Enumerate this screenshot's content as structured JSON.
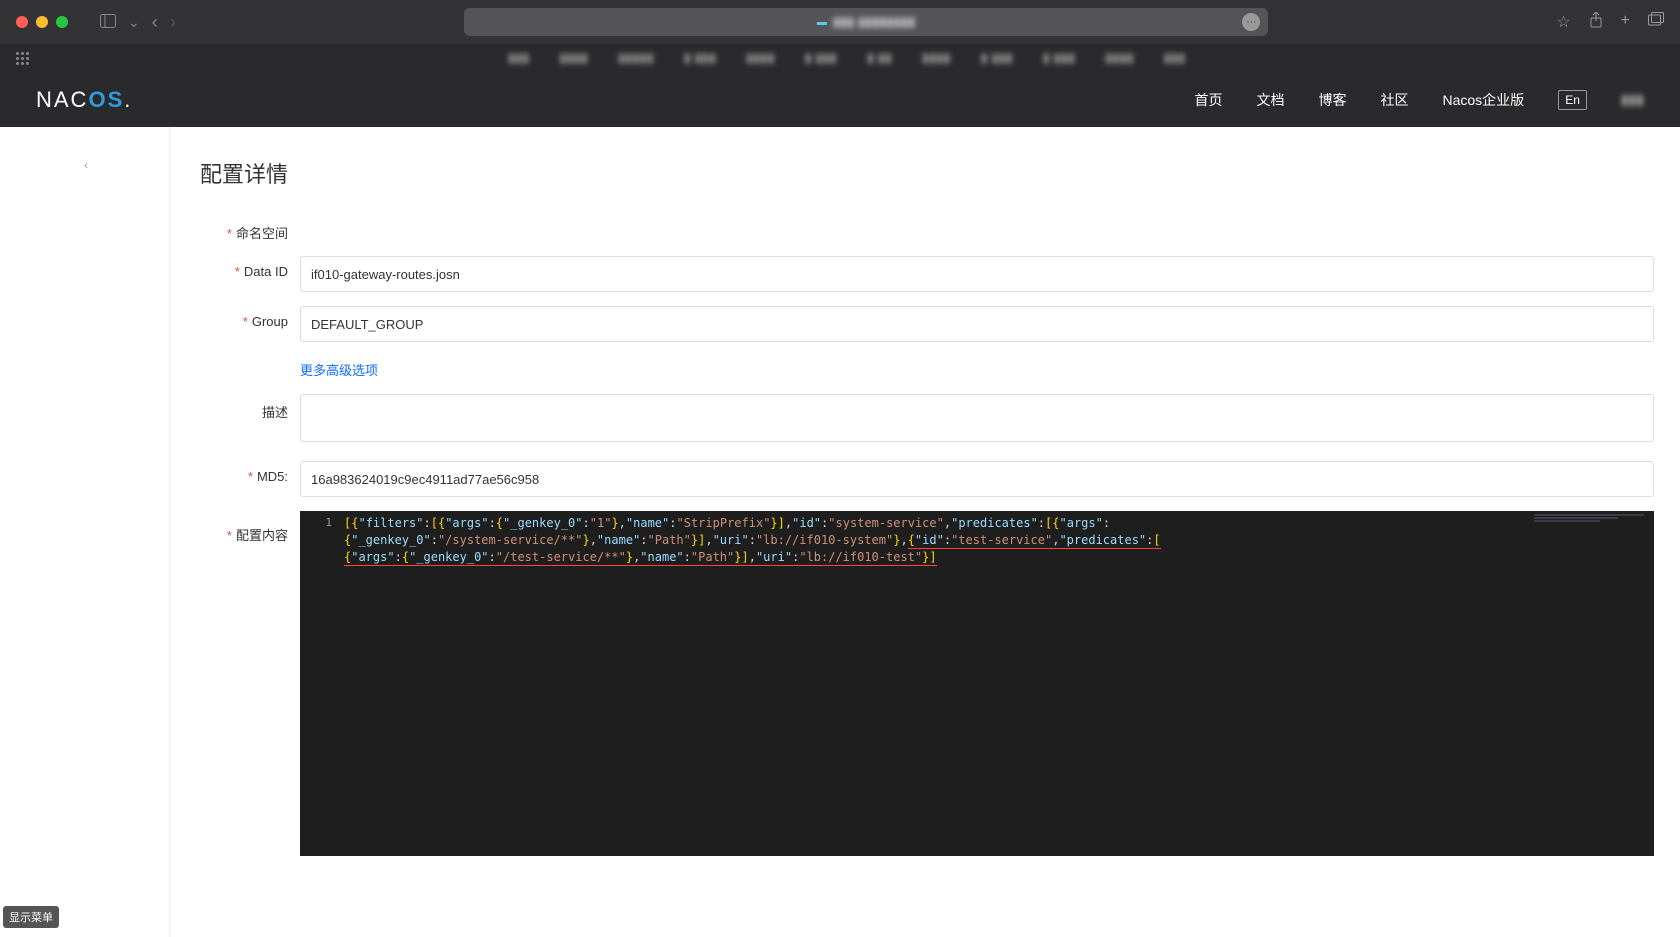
{
  "browser": {
    "addr_blur": "▮▮▮ ▮▮▮▮▮▮▮▮"
  },
  "nacos_header": {
    "nav": [
      "首页",
      "文档",
      "博客",
      "社区",
      "Nacos企业版"
    ],
    "lang": "En",
    "user_blur": "▮▮▮"
  },
  "page": {
    "title": "配置详情",
    "labels": {
      "namespace": "命名空间",
      "data_id": "Data ID",
      "group": "Group",
      "advanced": "更多高级选项",
      "desc": "描述",
      "md5": "MD5:",
      "content": "配置内容"
    },
    "values": {
      "data_id": "if010-gateway-routes.josn",
      "group": "DEFAULT_GROUP",
      "md5": "16a983624019c9ec4911ad77ae56c958"
    },
    "code_tokens": [
      [
        "bracket",
        "["
      ],
      [
        "brace",
        "{"
      ],
      [
        "key",
        "\"filters\""
      ],
      [
        "punc",
        ":"
      ],
      [
        "bracket",
        "["
      ],
      [
        "brace",
        "{"
      ],
      [
        "key",
        "\"args\""
      ],
      [
        "punc",
        ":"
      ],
      [
        "brace",
        "{"
      ],
      [
        "key",
        "\"_genkey_0\""
      ],
      [
        "punc",
        ":"
      ],
      [
        "str",
        "\"1\""
      ],
      [
        "brace",
        "}"
      ],
      [
        "punc",
        ","
      ],
      [
        "key",
        "\"name\""
      ],
      [
        "punc",
        ":"
      ],
      [
        "str",
        "\"StripPrefix\""
      ],
      [
        "brace",
        "}"
      ],
      [
        "bracket",
        "]"
      ],
      [
        "punc",
        ","
      ],
      [
        "key",
        "\"id\""
      ],
      [
        "punc",
        ":"
      ],
      [
        "str",
        "\"system-service\""
      ],
      [
        "punc",
        ","
      ],
      [
        "key",
        "\"predicates\""
      ],
      [
        "punc",
        ":"
      ],
      [
        "bracket",
        "["
      ],
      [
        "brace",
        "{"
      ],
      [
        "key",
        "\"args\""
      ],
      [
        "punc",
        ":"
      ],
      [
        "br",
        ""
      ],
      [
        "brace",
        "{"
      ],
      [
        "key",
        "\"_genkey_0\""
      ],
      [
        "punc",
        ":"
      ],
      [
        "str",
        "\"/system-service/**\""
      ],
      [
        "brace",
        "}"
      ],
      [
        "punc",
        ","
      ],
      [
        "key",
        "\"name\""
      ],
      [
        "punc",
        ":"
      ],
      [
        "str",
        "\"Path\""
      ],
      [
        "brace",
        "}"
      ],
      [
        "bracket",
        "]"
      ],
      [
        "punc",
        ","
      ],
      [
        "key",
        "\"uri\""
      ],
      [
        "punc",
        ":"
      ],
      [
        "str",
        "\"lb://if010-system\""
      ],
      [
        "brace",
        "}"
      ],
      [
        "punc",
        ","
      ],
      [
        "ul_start",
        ""
      ],
      [
        "brace",
        "{"
      ],
      [
        "key",
        "\"id\""
      ],
      [
        "punc",
        ":"
      ],
      [
        "str",
        "\"test-service\""
      ],
      [
        "punc",
        ","
      ],
      [
        "key",
        "\"predicates\""
      ],
      [
        "punc",
        ":"
      ],
      [
        "bracket",
        "["
      ],
      [
        "ul_end",
        ""
      ],
      [
        "br",
        ""
      ],
      [
        "ul_start",
        ""
      ],
      [
        "brace",
        "{"
      ],
      [
        "key",
        "\"args\""
      ],
      [
        "punc",
        ":"
      ],
      [
        "brace",
        "{"
      ],
      [
        "key",
        "\"_genkey_0\""
      ],
      [
        "punc",
        ":"
      ],
      [
        "str",
        "\"/test-service/**\""
      ],
      [
        "brace",
        "}"
      ],
      [
        "punc",
        ","
      ],
      [
        "key",
        "\"name\""
      ],
      [
        "punc",
        ":"
      ],
      [
        "str",
        "\"Path\""
      ],
      [
        "brace",
        "}"
      ],
      [
        "bracket",
        "]"
      ],
      [
        "punc",
        ","
      ],
      [
        "key",
        "\"uri\""
      ],
      [
        "punc",
        ":"
      ],
      [
        "str",
        "\"lb://if010-test\""
      ],
      [
        "brace",
        "}"
      ],
      [
        "bracket",
        "]"
      ],
      [
        "ul_end",
        ""
      ]
    ],
    "line_number": "1"
  },
  "tooltip": "显示菜单"
}
